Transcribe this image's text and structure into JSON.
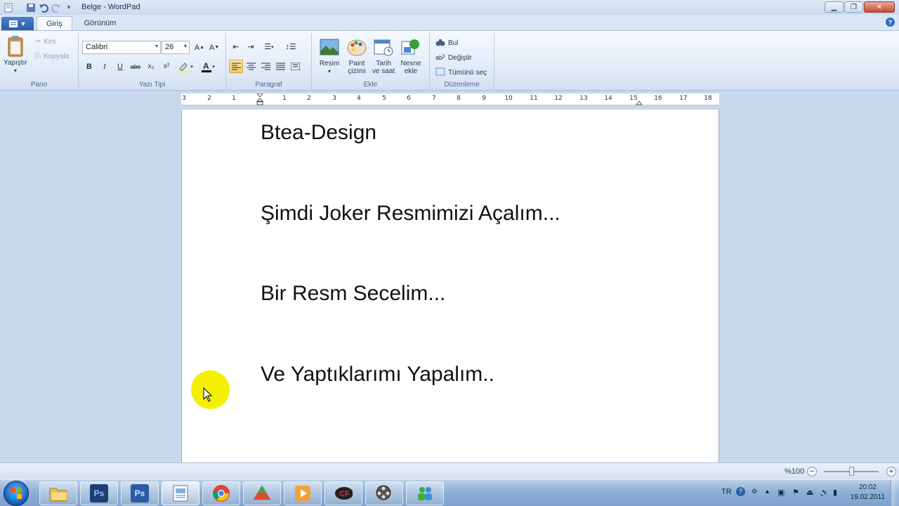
{
  "window": {
    "title": "Belge - WordPad",
    "quick_access": [
      "save-icon",
      "undo-icon",
      "redo-icon",
      "customize-icon"
    ],
    "controls": [
      "minimize",
      "maximize",
      "close"
    ]
  },
  "tabs": [
    {
      "label": "Giriş",
      "active": true
    },
    {
      "label": "Görünüm",
      "active": false
    }
  ],
  "ribbon": {
    "pano": {
      "label": "Pano",
      "paste": "Yapıştır",
      "cut": "Kes",
      "copy": "Kopyala"
    },
    "font": {
      "label": "Yazı Tipi",
      "family": "Calibri",
      "size": "26",
      "bold": "B",
      "italic": "I",
      "underline": "U",
      "strike": "abc",
      "subscript": "x₂",
      "superscript": "x²"
    },
    "paragraph": {
      "label": "Paragraf"
    },
    "insert": {
      "label": "Ekle",
      "picture": "Resim",
      "paint_line1": "Paint",
      "paint_line2": "çizimi",
      "datetime_line1": "Tarih",
      "datetime_line2": "ve saat",
      "object_line1": "Nesne",
      "object_line2": "ekle"
    },
    "editing": {
      "label": "Düzenleme",
      "find": "Bul",
      "replace": "Değiştir",
      "select_all": "Tümünü seç"
    }
  },
  "ruler": {
    "labels": [
      "3",
      "2",
      "1",
      "1",
      "2",
      "3",
      "4",
      "5",
      "6",
      "7",
      "8",
      "9",
      "10",
      "11",
      "12",
      "13",
      "14",
      "15",
      "16",
      "17",
      "18"
    ]
  },
  "document": {
    "lines": [
      "Btea-Design",
      "Şimdi Joker Resmimizi Açalım...",
      "Bir Resm Secelim...",
      "Ve Yaptıklarımı Yapalım.."
    ]
  },
  "status": {
    "zoom": "%100",
    "zoom_out": "−",
    "zoom_in": "+"
  },
  "taskbar": {
    "apps": [
      "explorer",
      "photoshop",
      "photoshop",
      "wordpad",
      "chrome",
      "app",
      "media-player",
      "game",
      "video",
      "messenger"
    ],
    "tray": {
      "language": "TR",
      "time": "20:02",
      "date": "19.02.2011"
    }
  }
}
